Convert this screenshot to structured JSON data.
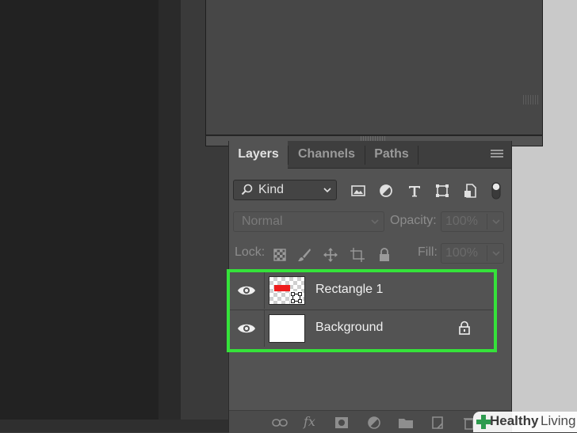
{
  "tabs": [
    {
      "label": "Layers",
      "active": true
    },
    {
      "label": "Channels",
      "active": false
    },
    {
      "label": "Paths",
      "active": false
    }
  ],
  "filter": {
    "kind_label": "Kind",
    "icons": [
      "image-filter-icon",
      "adjustment-filter-icon",
      "type-filter-icon",
      "shape-filter-icon",
      "smart-object-filter-icon",
      "filter-toggle-icon"
    ]
  },
  "blend": {
    "mode": "Normal",
    "opacity_label": "Opacity:",
    "opacity_value": "100%",
    "lock_label": "Lock:",
    "fill_label": "Fill:",
    "fill_value": "100%"
  },
  "layers": [
    {
      "name": "Rectangle 1",
      "visible": true,
      "locked": false,
      "thumbnail": "red-rectangle-on-transparent"
    },
    {
      "name": "Background",
      "visible": true,
      "locked": true,
      "thumbnail": "white"
    }
  ],
  "bottom_icons": [
    "link-layers-icon",
    "fx-icon",
    "add-mask-icon",
    "new-adjustment-icon",
    "new-group-icon",
    "new-layer-icon",
    "delete-layer-icon"
  ],
  "fx_label": "fx",
  "watermark": {
    "part1": "Healthy",
    "part2": "Living"
  },
  "colors": {
    "highlight": "#35e23a",
    "panel": "#535353",
    "rect_fill": "#ee1c1c"
  }
}
